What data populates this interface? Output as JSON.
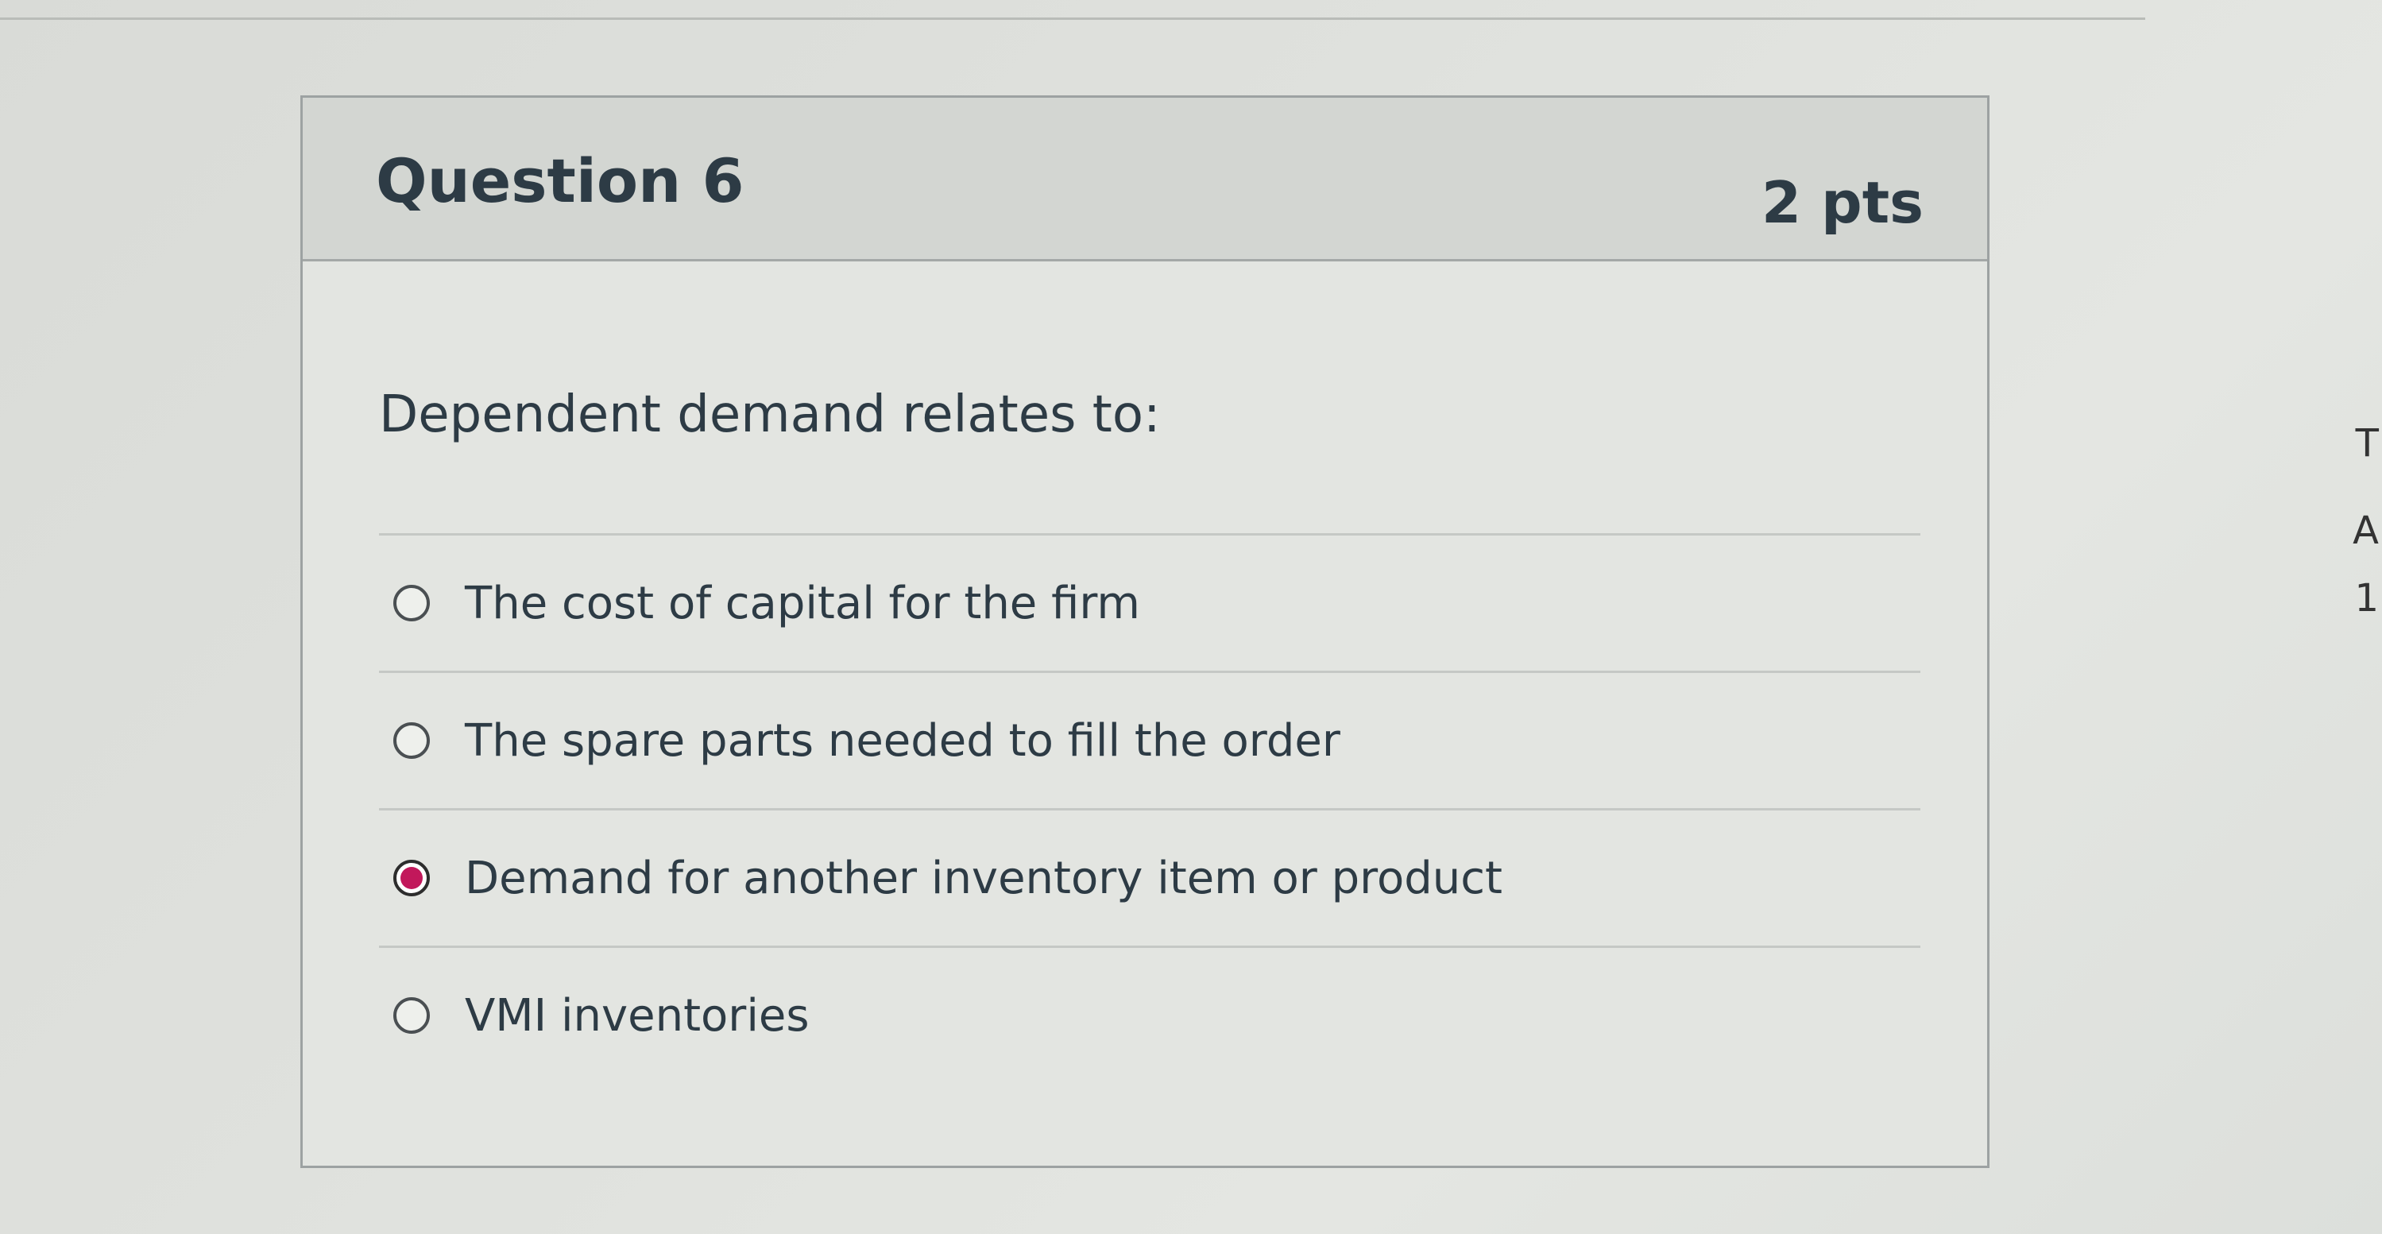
{
  "question": {
    "title": "Question 6",
    "points": "2 pts",
    "prompt": "Dependent demand relates to:"
  },
  "answers": [
    {
      "label": "The cost of capital for the firm",
      "selected": false
    },
    {
      "label": "The spare parts needed to fill the order",
      "selected": false
    },
    {
      "label": "Demand for another inventory item or product",
      "selected": true
    },
    {
      "label": "VMI inventories",
      "selected": false
    }
  ],
  "colors": {
    "selected_radio": "#c2185b",
    "text": "#2d3b45",
    "header_background": "#d3d6d2"
  },
  "edge_fragments": [
    "T",
    "A",
    "1"
  ]
}
